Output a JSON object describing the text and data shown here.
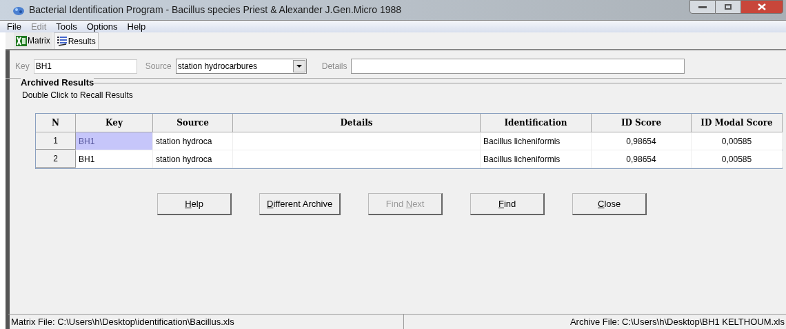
{
  "window": {
    "title": "Bacterial Identification Program - Bacillus species Priest & Alexander J.Gen.Micro 1988"
  },
  "menu": [
    {
      "label": "File",
      "disabled": false
    },
    {
      "label": "Edit",
      "disabled": true
    },
    {
      "label": "Tools",
      "disabled": false
    },
    {
      "label": "Options",
      "disabled": false
    },
    {
      "label": "Help",
      "disabled": false
    }
  ],
  "tabs": [
    {
      "label": "Matrix",
      "kind": "matrix",
      "selected": false
    },
    {
      "label": "Results",
      "kind": "results",
      "selected": true
    }
  ],
  "form": {
    "key_label": "Key",
    "key_value": "BH1",
    "source_label": "Source",
    "source_value": "station hydrocarbures",
    "details_label": "Details"
  },
  "archive": {
    "title": "Archived Results",
    "hint": "Double Click to Recall Results"
  },
  "table": {
    "columns": [
      "N",
      "Key",
      "Source",
      "Details",
      "Identification",
      "ID Score",
      "ID Modal Score"
    ],
    "rows": [
      {
        "n": "1",
        "key": "BH1",
        "source": "station hydroca",
        "identification": "Bacillus licheniformis",
        "id_score": "0,98654",
        "modal_score": "0,00585",
        "selected": true
      },
      {
        "n": "2",
        "key": "BH1",
        "source": "station hydroca",
        "identification": "Bacillus licheniformis",
        "id_score": "0,98654",
        "modal_score": "0,00585",
        "selected": false
      }
    ]
  },
  "buttons": [
    {
      "accel": "H",
      "after": "elp",
      "disabled": false
    },
    {
      "accel": "D",
      "after": "ifferent Archive",
      "disabled": false
    },
    {
      "before": "Find ",
      "accel": "N",
      "after": "ext",
      "disabled": true
    },
    {
      "accel": "F",
      "after": "ind",
      "disabled": false
    },
    {
      "accel": "C",
      "after": "lose",
      "disabled": false
    }
  ],
  "status_bar": [
    "Matrix File: C:\\Users\\h\\Desktop\\identification\\Bacillus.xls",
    "Archive File: C:\\Users\\h\\Desktop\\BH1 KELTHOUM.xls"
  ]
}
